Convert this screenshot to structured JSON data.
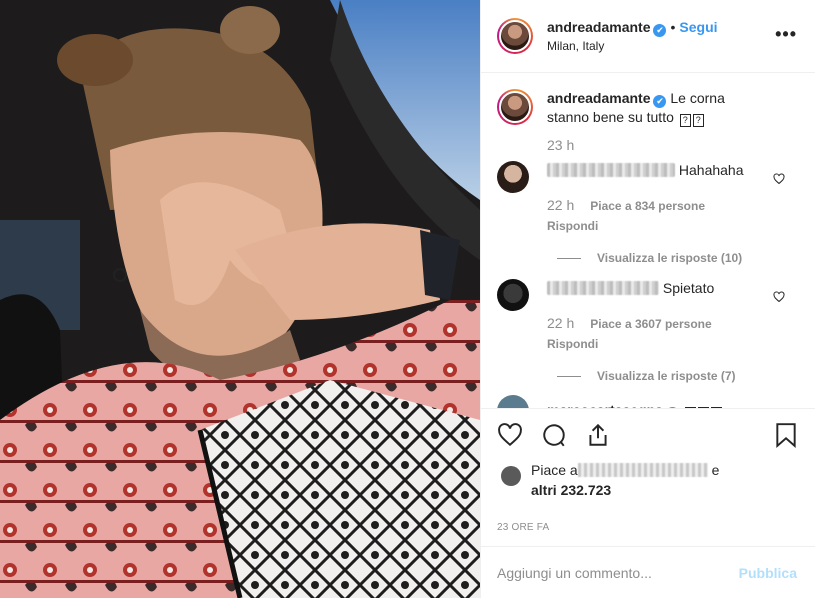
{
  "header": {
    "username": "andreadamante",
    "verified_mark": "✔",
    "separator": "•",
    "follow_label": "Segui",
    "location": "Milan, Italy",
    "more_icon": "more-horizontal-icon",
    "more_label": "•••"
  },
  "caption": {
    "username": "andreadamante",
    "text": "Le corna stanno bene su tutto",
    "glyph1": "?",
    "glyph2": "?",
    "time": "23 h"
  },
  "comments": [
    {
      "username_hidden": true,
      "text": "Hahahaha",
      "time": "22 h",
      "likes": "Piace a 834 persone",
      "reply_label": "Rispondi",
      "view_replies": "Visualizza le risposte (10)"
    },
    {
      "username_hidden": true,
      "text": "Spietato",
      "time": "22 h",
      "likes": "Piace a 3607 persone",
      "reply_label": "Rispondi",
      "view_replies": "Visualizza le risposte (7)"
    }
  ],
  "cutoff_comment": {
    "username": "marcocartasegna",
    "glyph": "?"
  },
  "likes": {
    "prefix": "Piace a",
    "suffix": "e",
    "count_text": "altri 232.723"
  },
  "posted_ago": "23 ORE FA",
  "add_comment": {
    "placeholder": "Aggiungi un commento...",
    "publish_label": "Pubblica"
  },
  "colors": {
    "link_blue": "#3897f0",
    "publish_disabled": "#b2dffc",
    "muted": "#8e8e8e"
  }
}
